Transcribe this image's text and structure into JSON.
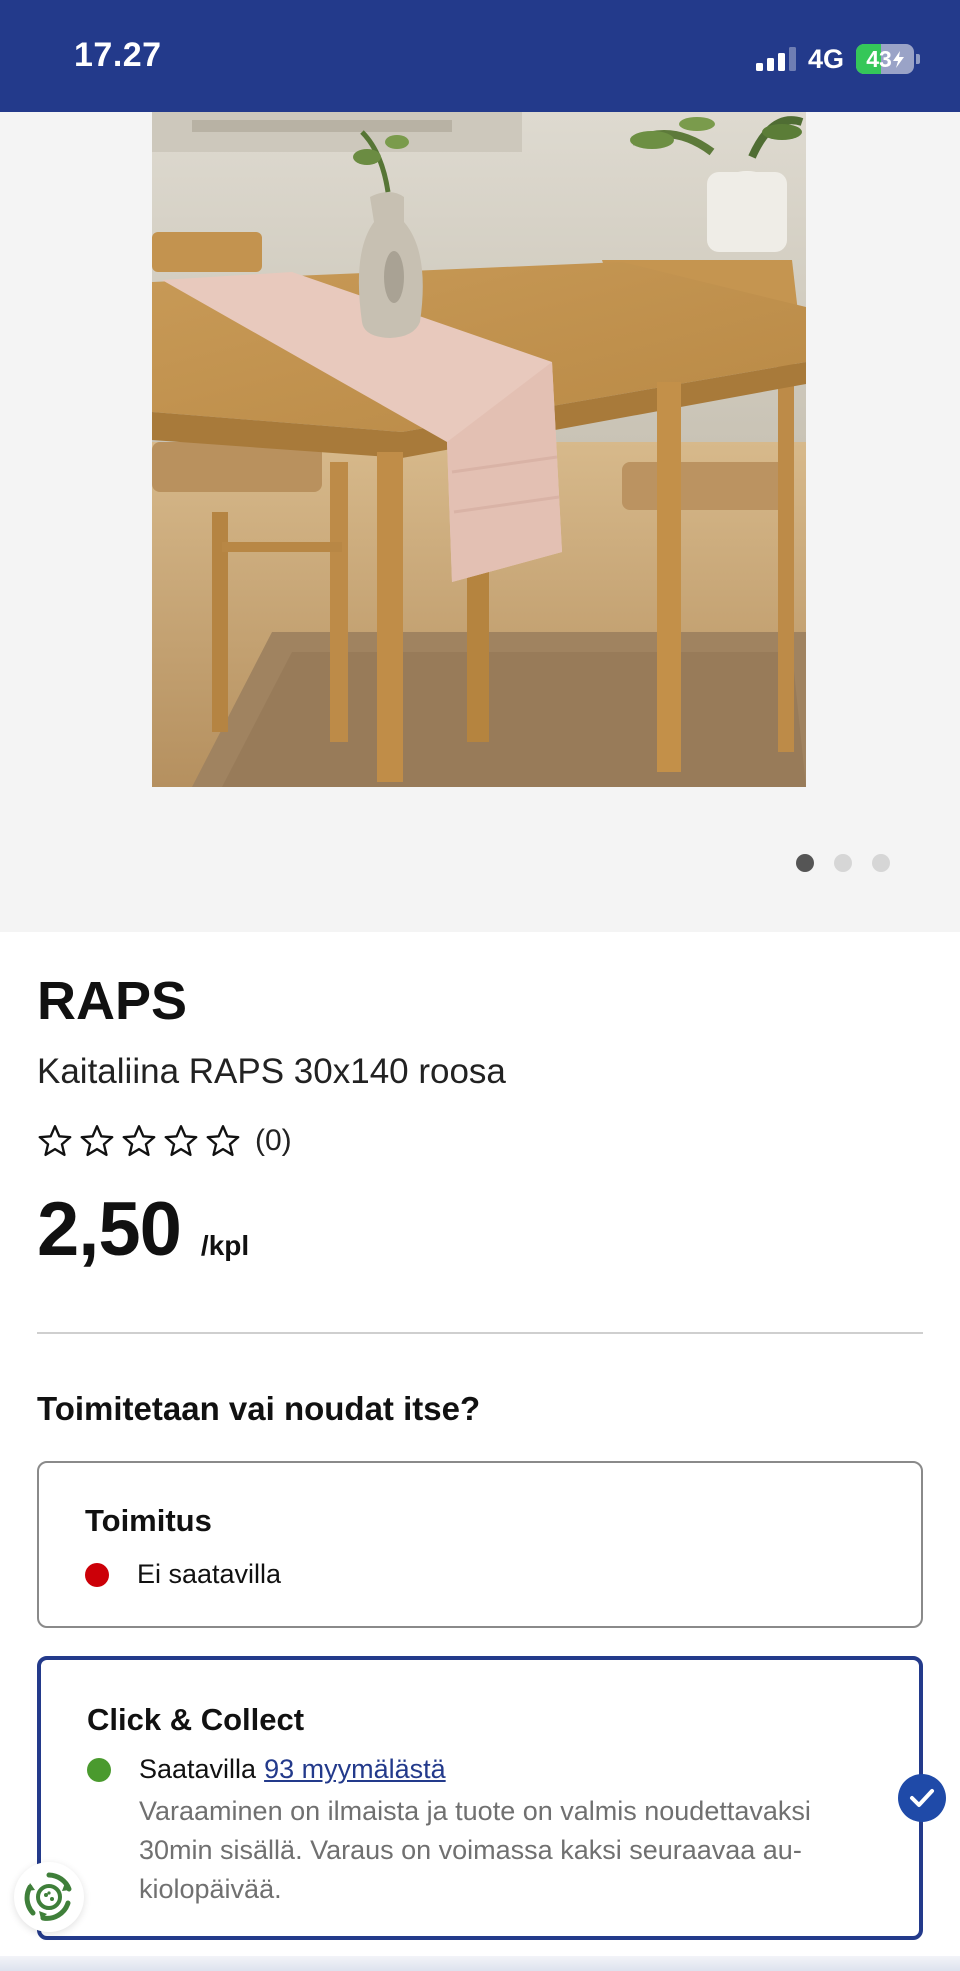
{
  "status_bar": {
    "time": "17.27",
    "network": "4G",
    "battery": "43",
    "battery_level": 0.43,
    "signal_bars": 3,
    "colors": {
      "background": "#233a8b",
      "battery_fill": "#35c759"
    }
  },
  "gallery": {
    "image_alt": "Kaitaliina RAPS on a wooden dining table",
    "pages": 3,
    "active_page": 1
  },
  "product": {
    "name": "RAPS",
    "description": "Kaitaliina RAPS 30x140 roosa",
    "rating": {
      "stars": 0,
      "max_stars": 5,
      "count": "(0)"
    },
    "price": "2,50",
    "unit": "/kpl"
  },
  "fulfillment": {
    "title": "Toimitetaan vai noudat itse?",
    "delivery": {
      "title": "Toimitus",
      "status": "Ei saatavilla",
      "status_color": "#cc0008"
    },
    "click_collect": {
      "title": "Click & Collect",
      "status": "Saatavilla",
      "stores_link": "93 myymälästä",
      "note": "Varaaminen on ilmaista ja tuote on valmis noudettavaksi 30min sisällä. Varaus on voimassa kaksi seuraavaa au-kiolopäivää.",
      "status_color": "#4a9a2e",
      "selected": true
    }
  },
  "icons": {
    "check": "check-icon",
    "eco": "recycle-icon",
    "star": "star-outline-icon"
  },
  "colors": {
    "brand_blue": "#233a8b",
    "link_blue": "#233a8b"
  }
}
